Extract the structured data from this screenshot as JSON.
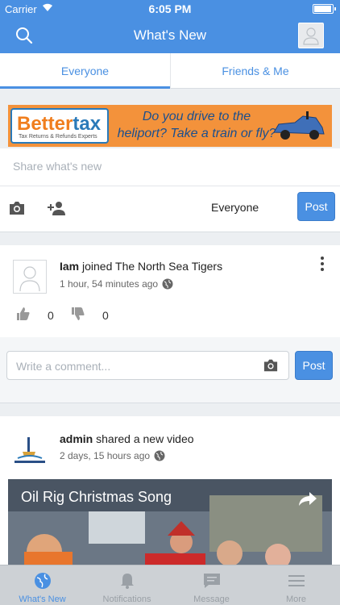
{
  "status": {
    "carrier": "Carrier",
    "time": "6:05 PM"
  },
  "header": {
    "title": "What's New"
  },
  "tabs": [
    {
      "label": "Everyone",
      "active": true
    },
    {
      "label": "Friends & Me",
      "active": false
    }
  ],
  "ad": {
    "brand_a": "Better",
    "brand_b": "tax",
    "subtitle": "Tax Returns & Refunds Experts",
    "tagline": "Do you drive to the heliport? Take a train or fly?"
  },
  "composer": {
    "placeholder": "Share what's new",
    "audience": "Everyone",
    "post_label": "Post"
  },
  "feed": [
    {
      "user": "Iam",
      "action": "joined The North Sea Tigers",
      "time": "1 hour, 54 minutes ago",
      "likes": "0",
      "dislikes": "0"
    },
    {
      "user": "admin",
      "action": "shared a new video",
      "time": "2 days, 15 hours ago",
      "video_title": "Oil Rig Christmas Song"
    }
  ],
  "comment": {
    "placeholder": "Write a comment...",
    "post_label": "Post"
  },
  "bottom_nav": [
    {
      "label": "What's New",
      "icon": "globe-icon",
      "active": true
    },
    {
      "label": "Notifications",
      "icon": "bell-icon",
      "active": false
    },
    {
      "label": "Message",
      "icon": "chat-icon",
      "active": false
    },
    {
      "label": "More",
      "icon": "menu-icon",
      "active": false
    }
  ],
  "colors": {
    "primary": "#4a90e2",
    "ad_orange": "#f3923b"
  }
}
